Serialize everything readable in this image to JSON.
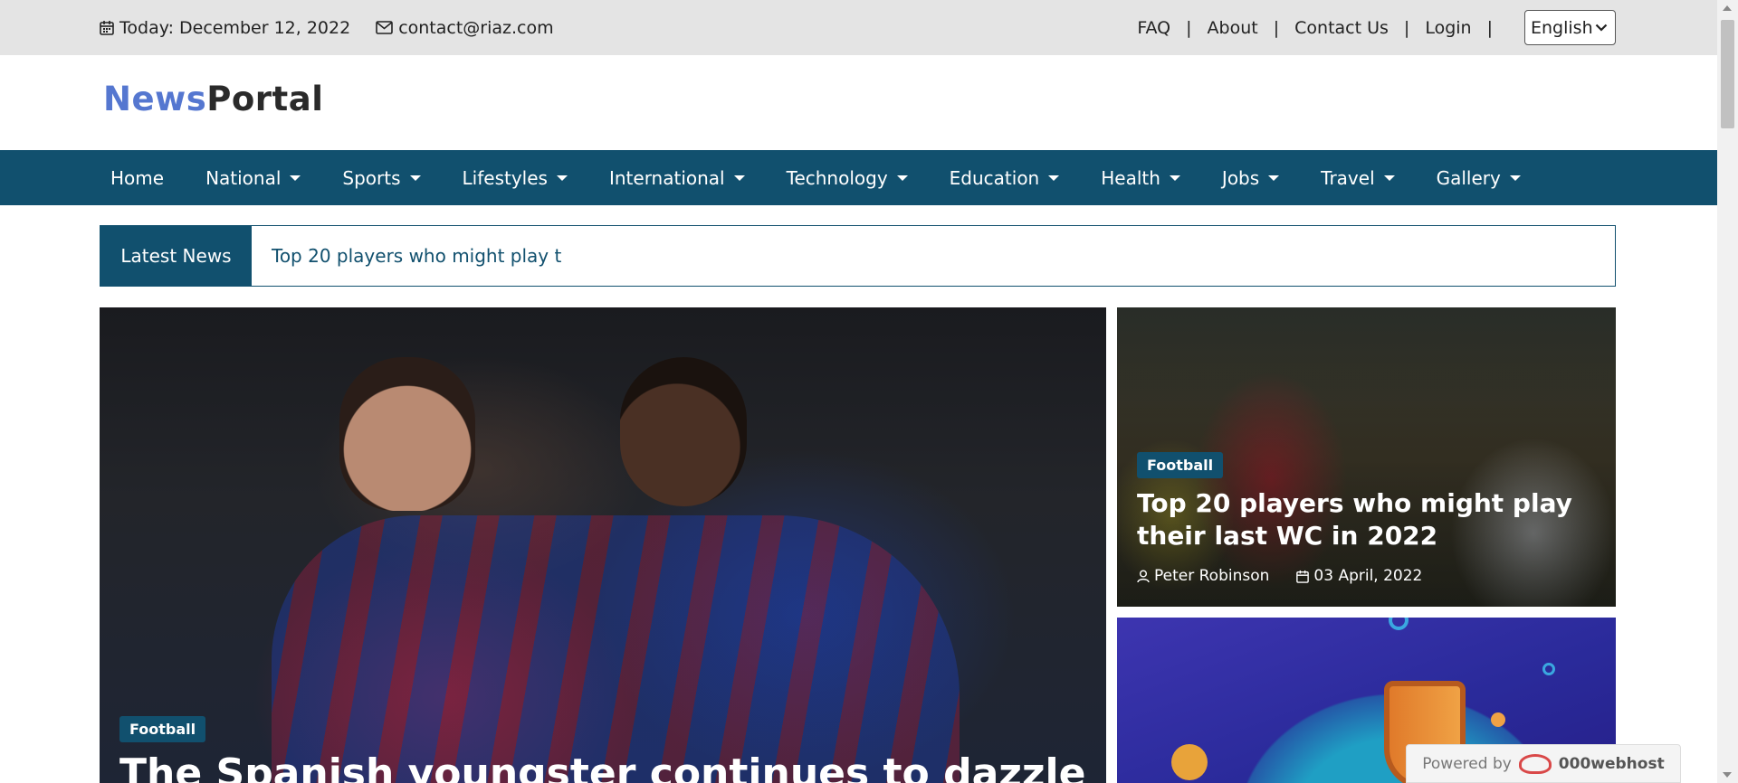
{
  "topbar": {
    "date_label": "Today: December 12, 2022",
    "email": "contact@riaz.com",
    "links": [
      "FAQ",
      "About",
      "Contact Us",
      "Login"
    ],
    "separator": "|",
    "language": "English"
  },
  "logo": {
    "part1": "News",
    "part2": "Portal"
  },
  "nav": {
    "items": [
      {
        "label": "Home",
        "dropdown": false
      },
      {
        "label": "National",
        "dropdown": true
      },
      {
        "label": "Sports",
        "dropdown": true
      },
      {
        "label": "Lifestyles",
        "dropdown": true
      },
      {
        "label": "International",
        "dropdown": true
      },
      {
        "label": "Technology",
        "dropdown": true
      },
      {
        "label": "Education",
        "dropdown": true
      },
      {
        "label": "Health",
        "dropdown": true
      },
      {
        "label": "Jobs",
        "dropdown": true
      },
      {
        "label": "Travel",
        "dropdown": true
      },
      {
        "label": "Gallery",
        "dropdown": true
      }
    ]
  },
  "latest": {
    "label": "Latest News",
    "ticker": "Top 20 players who might play t"
  },
  "feature": {
    "category": "Football",
    "title": "The Spanish youngster continues to dazzle"
  },
  "card1": {
    "category": "Football",
    "title": "Top 20 players who might play their last WC in 2022",
    "author": "Peter Robinson",
    "date": "03 April, 2022"
  },
  "powered": {
    "prefix": "Powered by",
    "brand": "000webhost"
  },
  "colors": {
    "primary": "#11506e",
    "logo_accent": "#5577d0",
    "topbar_bg": "#e4e4e4"
  },
  "icons": {
    "date": "calendar-icon",
    "email": "envelope-icon",
    "author": "user-icon",
    "post_date": "calendar-icon"
  }
}
